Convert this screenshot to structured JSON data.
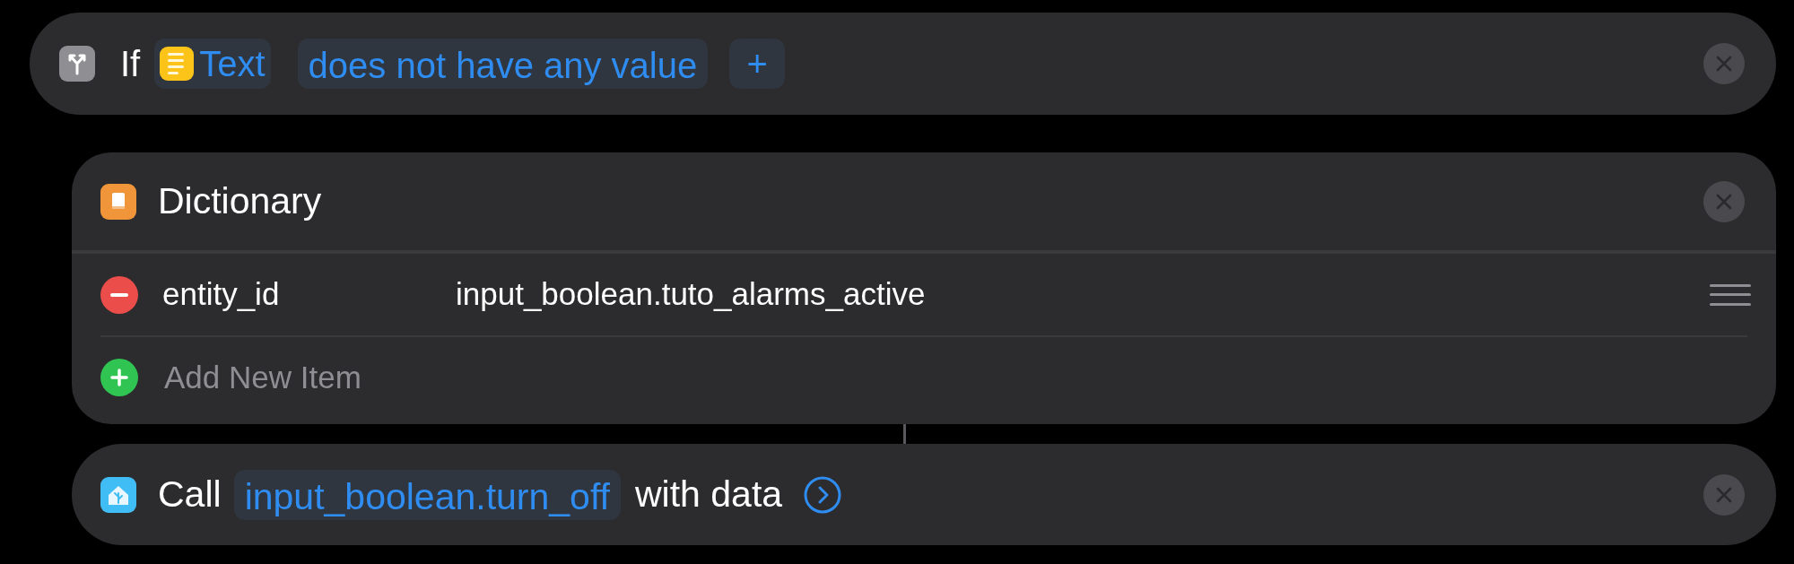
{
  "condition_block": {
    "label": "If",
    "input": {
      "label": "Text"
    },
    "condition": "does not have any value",
    "add_button": "+"
  },
  "dictionary_block": {
    "title": "Dictionary",
    "items": [
      {
        "key": "entity_id",
        "value": "input_boolean.tuto_alarms_active"
      }
    ],
    "add_item": "Add New Item"
  },
  "call_block": {
    "label": "Call",
    "service": "input_boolean.turn_off",
    "suffix": "with data"
  }
}
